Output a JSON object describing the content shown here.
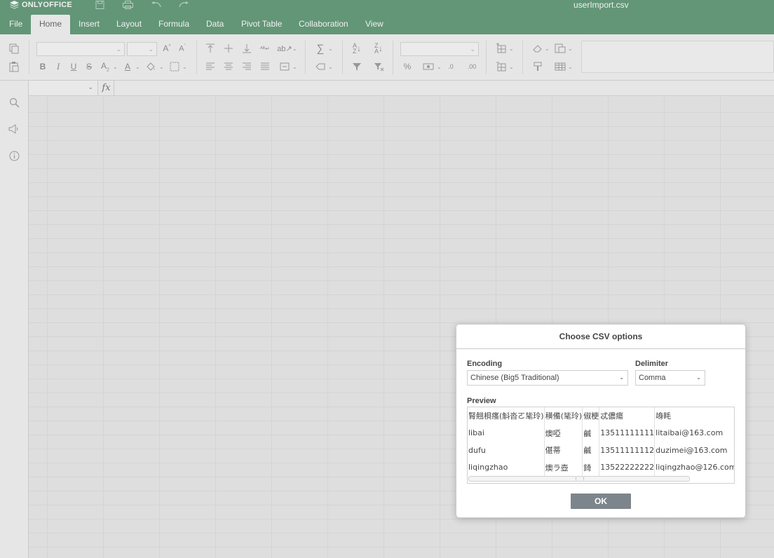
{
  "app": {
    "logo_text": "ONLYOFFICE",
    "document_title": "userImport.csv"
  },
  "quick_access": [
    {
      "icon": "save-icon"
    },
    {
      "icon": "print-icon"
    },
    {
      "icon": "undo-icon"
    },
    {
      "icon": "redo-icon"
    }
  ],
  "menu": {
    "tabs": [
      {
        "label": "File",
        "active": false
      },
      {
        "label": "Home",
        "active": true
      },
      {
        "label": "Insert",
        "active": false
      },
      {
        "label": "Layout",
        "active": false
      },
      {
        "label": "Formula",
        "active": false
      },
      {
        "label": "Data",
        "active": false
      },
      {
        "label": "Pivot Table",
        "active": false
      },
      {
        "label": "Collaboration",
        "active": false
      },
      {
        "label": "View",
        "active": false
      }
    ]
  },
  "toolbar": {
    "font_name": "",
    "font_size": "",
    "number_format": "",
    "format_labels": {
      "bold": "B",
      "italic": "I",
      "underline": "U",
      "strike": "S",
      "percent": "%",
      "dec_decrease": ".0",
      "dec_increase": ".00"
    }
  },
  "formula_bar": {
    "cell_reference": "",
    "fx_label": "fx",
    "formula": ""
  },
  "sidebar": [
    {
      "icon": "search-icon"
    },
    {
      "icon": "feedback-icon"
    },
    {
      "icon": "about-icon"
    }
  ],
  "dialog": {
    "title": "Choose CSV options",
    "encoding_label": "Encoding",
    "encoding_value": "Chinese (Big5 Traditional)",
    "delimiter_label": "Delimiter",
    "delimiter_value": "Comma",
    "preview_label": "Preview",
    "preview_rows": [
      [
        "腎翹梖瘙(斛沓ㄛ毞玲)",
        "穔備(毞玲)",
        "俶梗",
        "忒儂瘍",
        "竧眊"
      ],
      [
        "libai",
        "燠啞",
        "鹹",
        "13511111111",
        "litaibai@163.com"
      ],
      [
        "dufu",
        "偡蒂",
        "鹹",
        "13511111112",
        "duzimei@163.com"
      ],
      [
        "liqingzhao",
        "燠ラ壺",
        "錡",
        "13522222222",
        "liqingzhao@126.com"
      ]
    ],
    "ok_label": "OK"
  },
  "colors": {
    "brand": "#40865c",
    "ok_button": "#7d858c"
  }
}
